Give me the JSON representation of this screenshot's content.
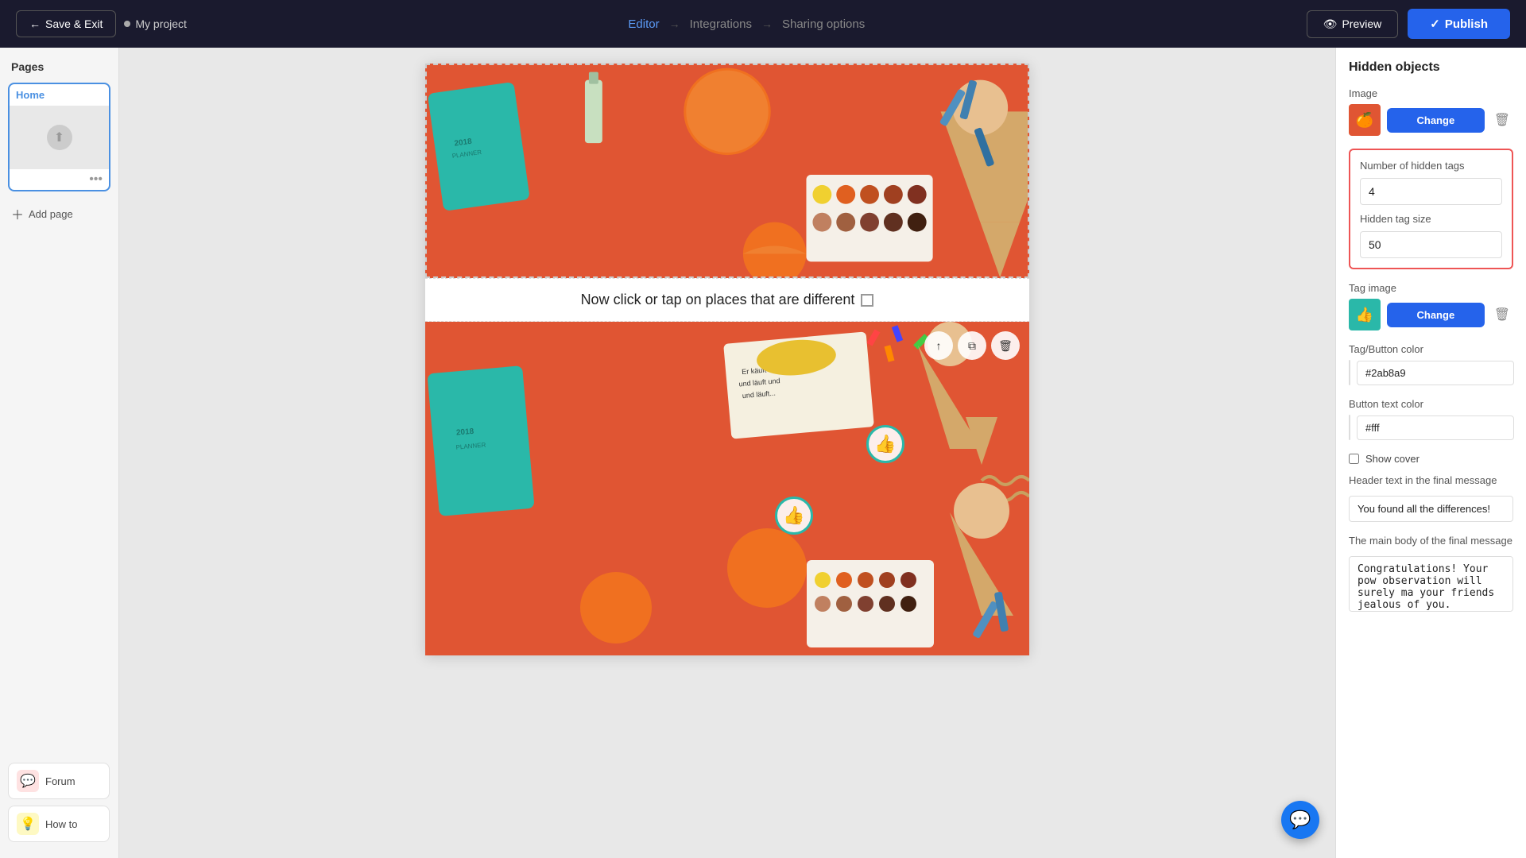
{
  "topnav": {
    "save_exit_label": "Save & Exit",
    "project_name": "My project",
    "editor_label": "Editor",
    "integrations_label": "Integrations",
    "sharing_options_label": "Sharing options",
    "preview_label": "Preview",
    "publish_label": "Publish"
  },
  "sidebar": {
    "pages_title": "Pages",
    "page_label": "Home",
    "add_page_label": "Add page",
    "tools": [
      {
        "id": "forum",
        "label": "Forum",
        "icon": "💬",
        "color": "red"
      },
      {
        "id": "how-to",
        "label": "How to",
        "icon": "💡",
        "color": "yellow"
      }
    ]
  },
  "canvas": {
    "caption": "Now click or tap on places that are different"
  },
  "right_panel": {
    "title": "Hidden objects",
    "image_label": "Image",
    "change_label": "Change",
    "hidden_tags_label": "Number of hidden tags",
    "hidden_tags_value": "4",
    "hidden_tag_size_label": "Hidden tag size",
    "hidden_tag_size_value": "50",
    "tag_image_label": "Tag image",
    "tag_button_color_label": "Tag/Button color",
    "tag_button_color_value": "#2ab8a9",
    "button_text_color_label": "Button text color",
    "button_text_color_value": "#fff",
    "show_cover_label": "Show cover",
    "header_text_label": "Header text in the final message",
    "header_text_value": "You found all the differences!",
    "main_body_label": "The main body of the final message",
    "main_body_value": "Congratulations! Your pow observation will surely ma your friends jealous of you."
  }
}
